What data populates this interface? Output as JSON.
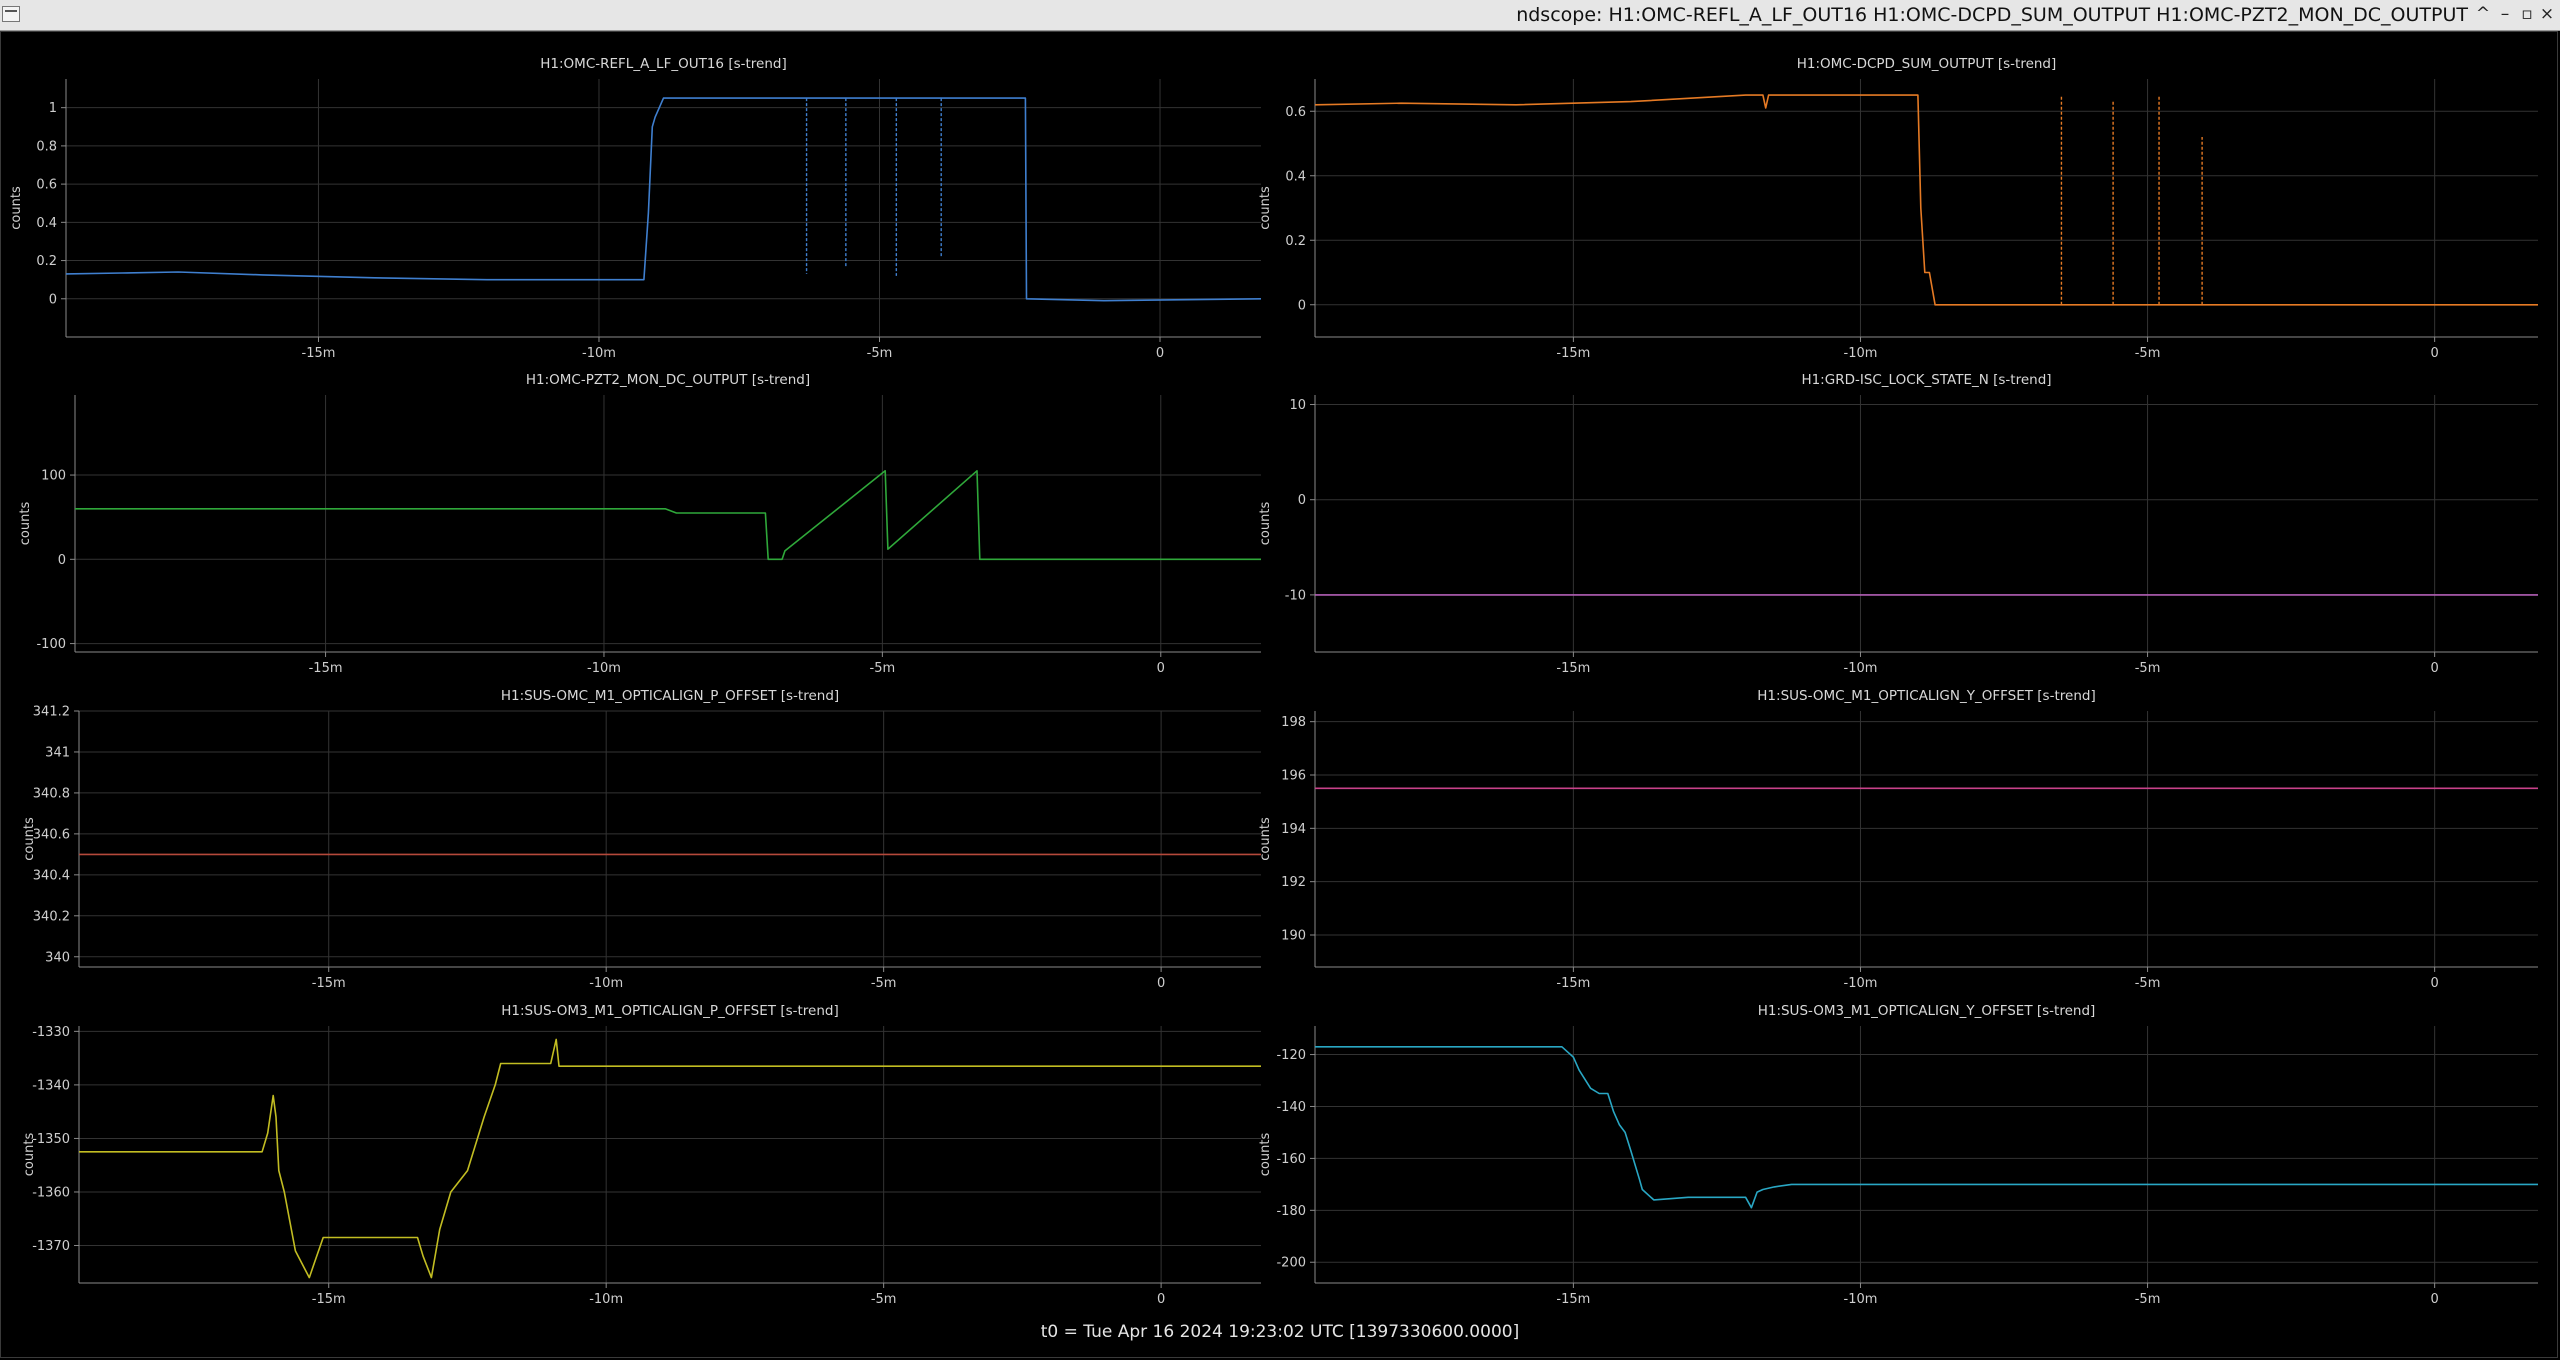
{
  "window": {
    "title": "ndscope: H1:OMC-REFL_A_LF_OUT16 H1:OMC-DCPD_SUM_OUTPUT H1:OMC-PZT2_MON_DC_OUTPUT",
    "buttons": [
      "^",
      "–",
      "▫",
      "×"
    ]
  },
  "footer": {
    "t0": "t0 = Tue Apr 16 2024 19:23:02 UTC [1397330600.0000]"
  },
  "colors": {
    "background": "#000000",
    "grid": "#333333",
    "axis": "#8a8a8a"
  },
  "chart_data": [
    {
      "type": "line",
      "title": "H1:OMC-REFL_A_LF_OUT16 [s-trend]",
      "ylabel": "counts",
      "color": "#3f7fcf",
      "xlim": [
        -19.5,
        1.8
      ],
      "ylim": [
        -0.2,
        1.15
      ],
      "xticks": [
        -15,
        -10,
        -5,
        0
      ],
      "xtick_labels": [
        "-15m",
        "-10m",
        "-5m",
        "0"
      ],
      "yticks": [
        0,
        0.2,
        0.4,
        0.6,
        0.8,
        1
      ],
      "ytick_labels": [
        "0",
        "0.2",
        "0.4",
        "0.6",
        "0.8",
        "1"
      ],
      "x": [
        -19.5,
        -18.5,
        -17.5,
        -16,
        -14,
        -12,
        -10.5,
        -9.2,
        -9.12,
        -9.05,
        -9.0,
        -8.85,
        -8.5,
        -7,
        -5,
        -3,
        -2.4,
        -2.38,
        -1,
        1.8
      ],
      "y": [
        0.13,
        0.135,
        0.14,
        0.125,
        0.11,
        0.1,
        0.1,
        0.1,
        0.45,
        0.9,
        0.95,
        1.05,
        1.05,
        1.05,
        1.05,
        1.05,
        1.05,
        0,
        -0.01,
        0
      ],
      "spikes": [
        {
          "x": -6.3,
          "y": 0.13
        },
        {
          "x": -5.6,
          "y": 0.17
        },
        {
          "x": -4.7,
          "y": 0.12
        },
        {
          "x": -3.9,
          "y": 0.22
        }
      ]
    },
    {
      "type": "line",
      "title": "H1:OMC-DCPD_SUM_OUTPUT [s-trend]",
      "ylabel": "counts",
      "color": "#e57a24",
      "xlim": [
        -19.5,
        1.8
      ],
      "ylim": [
        -0.1,
        0.7
      ],
      "xticks": [
        -15,
        -10,
        -5,
        0
      ],
      "xtick_labels": [
        "-15m",
        "-10m",
        "-5m",
        "0"
      ],
      "yticks": [
        0,
        0.2,
        0.4,
        0.6
      ],
      "ytick_labels": [
        "0",
        "0.2",
        "0.4",
        "0.6"
      ],
      "x": [
        -19.5,
        -18,
        -16,
        -14,
        -12,
        -11.7,
        -11.65,
        -11.6,
        -10,
        -9.0,
        -8.95,
        -8.88,
        -8.8,
        -8.7,
        -8,
        -5,
        -3,
        0,
        1.8
      ],
      "y": [
        0.62,
        0.625,
        0.62,
        0.63,
        0.65,
        0.65,
        0.61,
        0.65,
        0.65,
        0.65,
        0.3,
        0.1,
        0.1,
        0,
        0,
        0,
        0,
        0,
        0
      ],
      "spikes": [
        {
          "x": -6.5,
          "y": 0.65
        },
        {
          "x": -5.6,
          "y": 0.63
        },
        {
          "x": -4.8,
          "y": 0.65
        },
        {
          "x": -4.05,
          "y": 0.52
        }
      ]
    },
    {
      "type": "line",
      "title": "H1:OMC-PZT2_MON_DC_OUTPUT [s-trend]",
      "ylabel": "counts",
      "color": "#2fa83a",
      "xlim": [
        -19.5,
        1.8
      ],
      "ylim": [
        -110,
        195
      ],
      "xticks": [
        -15,
        -10,
        -5,
        0
      ],
      "xtick_labels": [
        "-15m",
        "-10m",
        "-5m",
        "0"
      ],
      "yticks": [
        -100,
        0,
        100
      ],
      "ytick_labels": [
        "-100",
        "0",
        "100"
      ],
      "x": [
        -19.5,
        -12,
        -10,
        -8.9,
        -8.7,
        -7.1,
        -7.05,
        -6.8,
        -6.75,
        -4.95,
        -4.9,
        -3.3,
        -3.25,
        0,
        1.8
      ],
      "y": [
        60,
        60,
        60,
        60,
        55,
        55,
        0,
        0,
        10,
        105,
        12,
        105,
        0,
        0,
        0
      ]
    },
    {
      "type": "line",
      "title": "H1:GRD-ISC_LOCK_STATE_N [s-trend]",
      "ylabel": "counts",
      "color": "#b25fb5",
      "xlim": [
        -19.5,
        1.8
      ],
      "ylim": [
        -16,
        11
      ],
      "xticks": [
        -15,
        -10,
        -5,
        0
      ],
      "xtick_labels": [
        "-15m",
        "-10m",
        "-5m",
        "0"
      ],
      "yticks": [
        -10,
        0,
        10
      ],
      "ytick_labels": [
        "-10",
        "0",
        "10"
      ],
      "x": [
        -19.5,
        1.8
      ],
      "y": [
        -10,
        -10
      ]
    },
    {
      "type": "line",
      "title": "H1:SUS-OMC_M1_OPTICALIGN_P_OFFSET [s-trend]",
      "ylabel": "counts",
      "color": "#b5493b",
      "xlim": [
        -19.5,
        1.8
      ],
      "ylim": [
        339.95,
        341.2
      ],
      "xticks": [
        -15,
        -10,
        -5,
        0
      ],
      "xtick_labels": [
        "-15m",
        "-10m",
        "-5m",
        "0"
      ],
      "yticks": [
        340,
        340.2,
        340.4,
        340.6,
        340.8,
        341,
        341.2
      ],
      "ytick_labels": [
        "340",
        "340.2",
        "340.4",
        "340.6",
        "340.8",
        "341",
        "341.2"
      ],
      "x": [
        -19.5,
        1.8
      ],
      "y": [
        340.5,
        340.5
      ]
    },
    {
      "type": "line",
      "title": "H1:SUS-OMC_M1_OPTICALIGN_Y_OFFSET [s-trend]",
      "ylabel": "counts",
      "color": "#c8428a",
      "xlim": [
        -19.5,
        1.8
      ],
      "ylim": [
        188.8,
        198.4
      ],
      "xticks": [
        -15,
        -10,
        -5,
        0
      ],
      "xtick_labels": [
        "-15m",
        "-10m",
        "-5m",
        "0"
      ],
      "yticks": [
        190,
        192,
        194,
        196,
        198
      ],
      "ytick_labels": [
        "190",
        "192",
        "194",
        "196",
        "198"
      ],
      "x": [
        -19.5,
        1.8
      ],
      "y": [
        195.5,
        195.5
      ]
    },
    {
      "type": "line",
      "title": "H1:SUS-OM3_M1_OPTICALIGN_P_OFFSET [s-trend]",
      "ylabel": "counts",
      "color": "#c2bd22",
      "xlim": [
        -19.5,
        1.8
      ],
      "ylim": [
        -1377,
        -1329
      ],
      "xticks": [
        -15,
        -10,
        -5,
        0
      ],
      "xtick_labels": [
        "-15m",
        "-10m",
        "-5m",
        "0"
      ],
      "yticks": [
        -1370,
        -1360,
        -1350,
        -1340,
        -1330
      ],
      "ytick_labels": [
        "-1370",
        "-1360",
        "-1350",
        "-1340",
        "-1330"
      ],
      "x": [
        -19.5,
        -16.2,
        -16.1,
        -16.0,
        -15.95,
        -15.9,
        -15.8,
        -15.6,
        -15.35,
        -15.25,
        -15.1,
        -14.9,
        -13.4,
        -13.3,
        -13.15,
        -13.0,
        -12.8,
        -12.5,
        -12.2,
        -12.0,
        -11.9,
        -11.8,
        -11.0,
        -10.9,
        -10.85,
        -10.8,
        -10.0,
        -8,
        -5,
        0,
        1.8
      ],
      "y": [
        -1352.5,
        -1352.5,
        -1349,
        -1342,
        -1346,
        -1356,
        -1360,
        -1371,
        -1376,
        -1373,
        -1368.5,
        -1368.5,
        -1368.5,
        -1372,
        -1376,
        -1367,
        -1360,
        -1356,
        -1346,
        -1340,
        -1336,
        -1336,
        -1336,
        -1331.5,
        -1336.5,
        -1336.5,
        -1336.5,
        -1336.5,
        -1336.5,
        -1336.5,
        -1336.5
      ]
    },
    {
      "type": "line",
      "title": "H1:SUS-OM3_M1_OPTICALIGN_Y_OFFSET [s-trend]",
      "ylabel": "counts",
      "color": "#29a7c4",
      "xlim": [
        -19.5,
        1.8
      ],
      "ylim": [
        -208,
        -109
      ],
      "xticks": [
        -15,
        -10,
        -5,
        0
      ],
      "xtick_labels": [
        "-15m",
        "-10m",
        "-5m",
        "0"
      ],
      "yticks": [
        -200,
        -180,
        -160,
        -140,
        -120
      ],
      "ytick_labels": [
        "-200",
        "-180",
        "-160",
        "-140",
        "-120"
      ],
      "x": [
        -19.5,
        -15.2,
        -15.0,
        -14.9,
        -14.7,
        -14.55,
        -14.4,
        -14.3,
        -14.2,
        -14.1,
        -14.0,
        -13.85,
        -13.8,
        -13.6,
        -13.0,
        -12.0,
        -11.9,
        -11.8,
        -11.7,
        -11.5,
        -11.2,
        -11.0,
        -10,
        -5,
        0,
        1.8
      ],
      "y": [
        -117,
        -117,
        -121,
        -126,
        -133,
        -135,
        -135,
        -142,
        -147,
        -150,
        -157,
        -168,
        -172,
        -176,
        -175,
        -175,
        -179,
        -173,
        -172,
        -171,
        -170,
        -170,
        -170,
        -170,
        -170,
        -170
      ]
    }
  ]
}
